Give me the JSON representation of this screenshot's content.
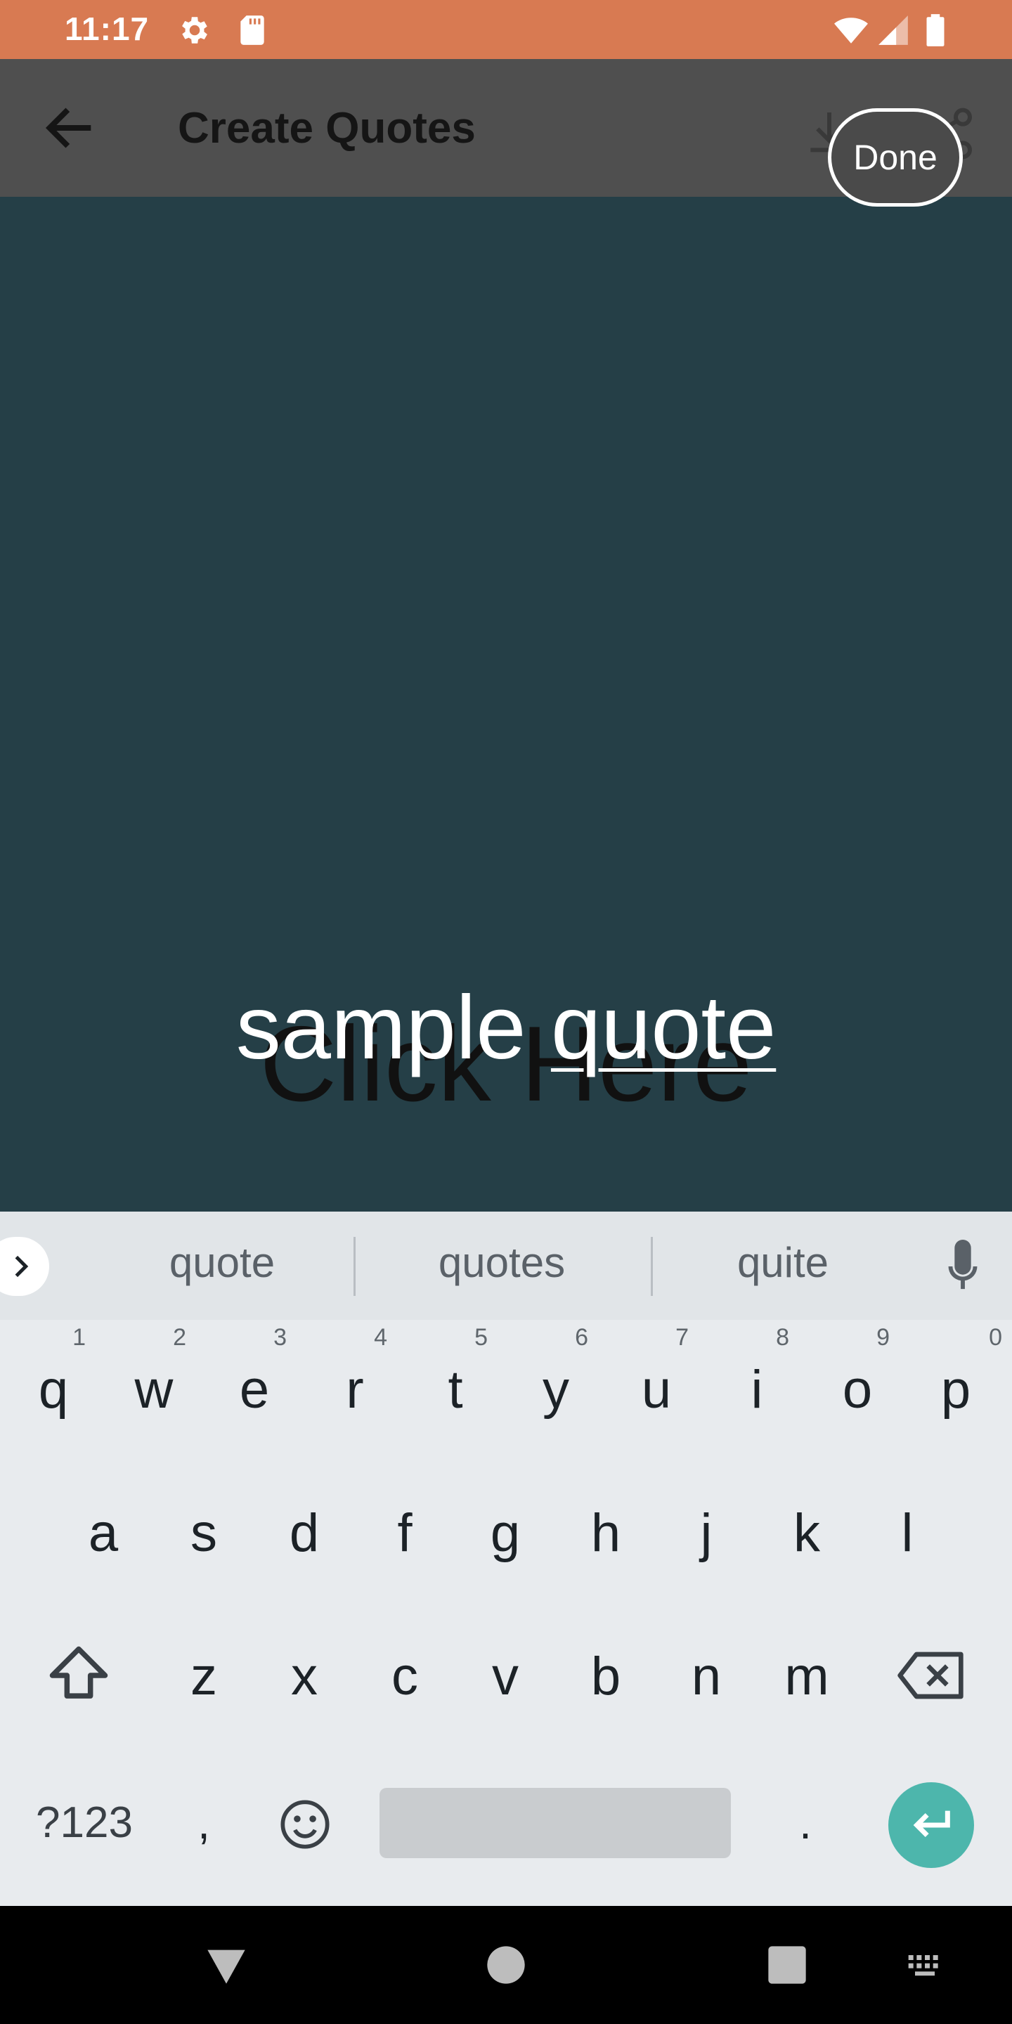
{
  "status_bar": {
    "time": "11:17",
    "bg_color": "#d87a52",
    "icons": [
      "settings-icon",
      "sd-card-icon",
      "wifi-icon",
      "signal-icon",
      "battery-icon"
    ]
  },
  "app_bar": {
    "title": "Create Quotes",
    "back_icon": "arrow-left-icon",
    "action_icons": [
      "download-icon",
      "share-icon"
    ],
    "bg_color": "#4f4f4f"
  },
  "done_button": {
    "label": "Done"
  },
  "canvas": {
    "bg_color": "#253f47",
    "placeholder": "Click Here",
    "quote_word_1": "sample",
    "quote_word_2": "quote"
  },
  "keyboard": {
    "suggestions": [
      "quote",
      "quotes",
      "quite"
    ],
    "row1": [
      {
        "key": "q",
        "hint": "1"
      },
      {
        "key": "w",
        "hint": "2"
      },
      {
        "key": "e",
        "hint": "3"
      },
      {
        "key": "r",
        "hint": "4"
      },
      {
        "key": "t",
        "hint": "5"
      },
      {
        "key": "y",
        "hint": "6"
      },
      {
        "key": "u",
        "hint": "7"
      },
      {
        "key": "i",
        "hint": "8"
      },
      {
        "key": "o",
        "hint": "9"
      },
      {
        "key": "p",
        "hint": "0"
      }
    ],
    "row2": [
      "a",
      "s",
      "d",
      "f",
      "g",
      "h",
      "j",
      "k",
      "l"
    ],
    "row3": [
      "z",
      "x",
      "c",
      "v",
      "b",
      "n",
      "m"
    ],
    "symbols_label": "?123",
    "comma": ",",
    "period": ".",
    "enter_color": "#4db6ac"
  },
  "nav_bar": {
    "icons": [
      "back-triangle-icon",
      "home-circle-icon",
      "recents-square-icon",
      "keyboard-icon"
    ]
  }
}
